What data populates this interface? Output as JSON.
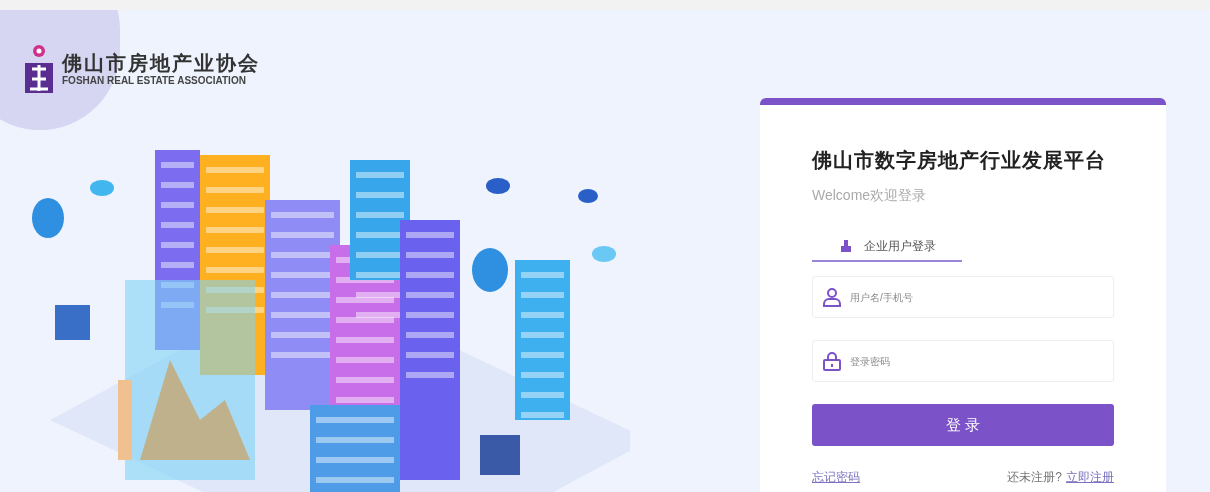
{
  "logo": {
    "name": "佛山市房地产业协会",
    "subtitle": "FOSHAN REAL ESTATE ASSOCIATION"
  },
  "login": {
    "title": "佛山市数字房地产行业发展平台",
    "welcome": "Welcome欢迎登录",
    "tabs": [
      {
        "label": "企业用户登录",
        "selected": true
      }
    ],
    "fields": [
      {
        "kind": "user",
        "placeholder": "用户名/手机号"
      },
      {
        "kind": "password",
        "placeholder": "登录密码"
      }
    ],
    "submit": "登 录",
    "forgot": "忘记密码",
    "register_prompt": "还未注册?",
    "register_link": "立即注册"
  }
}
